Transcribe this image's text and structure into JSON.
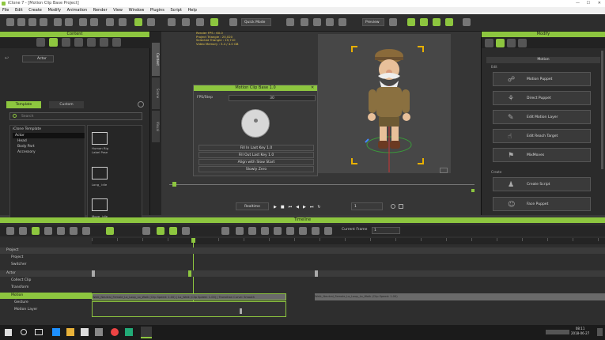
{
  "app": {
    "title": "iClone 7 - [Motion Clip Base Project]",
    "minimize_glyph": "—",
    "maximize_glyph": "☐",
    "close_glyph": "✕"
  },
  "menu": [
    "File",
    "Edit",
    "Create",
    "Modify",
    "Animation",
    "Render",
    "View",
    "Window",
    "Plugins",
    "Script",
    "Help"
  ],
  "toolbar": {
    "quick_mode": "Quick Mode",
    "preview": "Preview"
  },
  "content_panel": {
    "title": "Content",
    "tabs": [
      "Template",
      "Custom"
    ],
    "search_placeholder": "Search",
    "nav_path": "Actor",
    "tree_items": [
      "iClone Template",
      "Actor",
      "Head",
      "Body Part",
      "Accessory"
    ],
    "thumbs": [
      "Human Rig Label Pose",
      "Long_ idle",
      "Move_ idle"
    ]
  },
  "side_tabs": [
    "Content",
    "Scene",
    "Visual"
  ],
  "stats": {
    "line1": "Render FPS : 60.0",
    "line2": "Project Triangle : 20,020",
    "line3": "Selected Triangle : 19,710",
    "line4": "Video Memory : 3.4 / 4.0 GB"
  },
  "motion_clip": {
    "title": "Motion Clip Base 1.0",
    "field_label": "FPS/Step",
    "field_value": "30",
    "buttons": [
      "Fill In Last Key 1.0",
      "Fill Out Last Key 1.0",
      "Align with Slow Start",
      "Slowly Zero"
    ]
  },
  "playback": {
    "mode": "Realtime",
    "frame": "1"
  },
  "modify_panel": {
    "title": "Modify",
    "section_title": "Motion",
    "group_edit": "Edit",
    "group_create": "Create",
    "edit_buttons": [
      "Motion Puppet",
      "Direct Puppet",
      "Edit Motion Layer",
      "Edit Reach Target",
      "MixMoves"
    ],
    "create_buttons": [
      "Create Script",
      "Face Puppet"
    ]
  },
  "timeline": {
    "title": "Timeline",
    "current_frame_label": "Current Frame",
    "current_frame": "1",
    "rows": [
      "Project",
      "Project",
      "Switcher",
      "Actor",
      "Collect Clip",
      "Transform",
      "Motion",
      "Gesture",
      "Motion Layer"
    ],
    "clip_text_1": "Walk_Neutral_Female_Lo_Loop_Lo_Walk (Clip Speed: 1.00) | Lo_Walk (Clip Speed: 1.00) | Transition Curve: Smooth",
    "clip_text_2": "Walk_Neutral_Female_Lo_Loop_Lo_Walk (Clip Speed: 1.00)"
  },
  "taskbar": {
    "time": "08:11",
    "date": "2018-06-27"
  },
  "colors": {
    "accent": "#8dc63f",
    "panel": "#2b2b2b",
    "viewport_bg": "#363636"
  }
}
